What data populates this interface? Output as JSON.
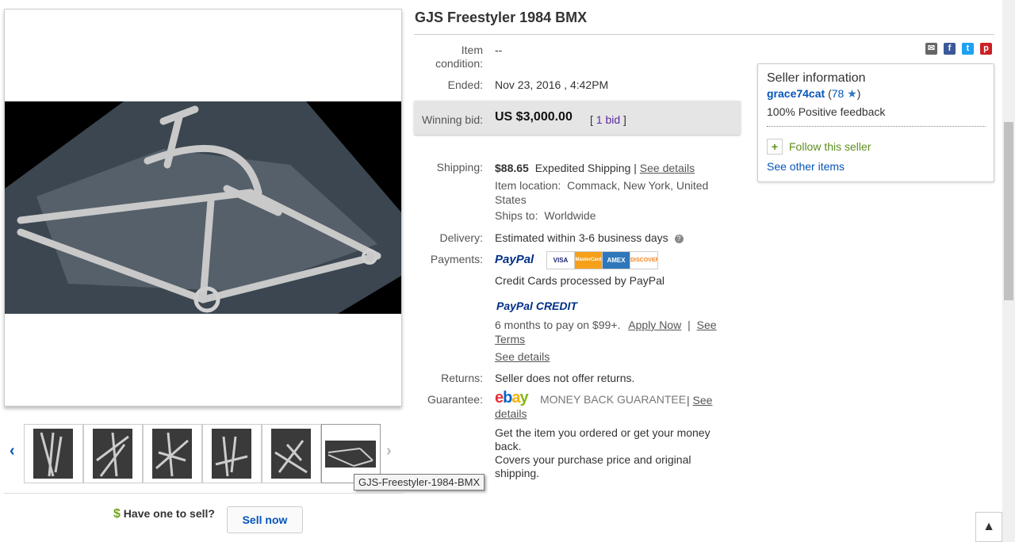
{
  "title": "GJS Freestyler 1984 BMX",
  "details": {
    "condition_label": "Item condition:",
    "condition_value": "--",
    "ended_label": "Ended:",
    "ended_value": "Nov 23, 2016 , 4:42PM",
    "winning_label": "Winning bid:",
    "winning_value": "US $3,000.00",
    "bids_open": "[",
    "bids_link": "1 bid",
    "bids_close": "]",
    "shipping_label": "Shipping:",
    "shipping_cost": "$88.65",
    "shipping_method": "Expedited Shipping |",
    "shipping_see_details": "See details",
    "location_label": "Item location:",
    "location_value_1": "Commack, New York, United",
    "location_value_2": "States",
    "ships_to_label": "Ships to:",
    "ships_to_value": "Worldwide",
    "delivery_label": "Delivery:",
    "delivery_value": "Estimated within 3-6 business days",
    "payments_label": "Payments:",
    "paypal_logo": "PayPal",
    "cards": [
      "VISA",
      "MasterCard",
      "AMEX",
      "DISCOVER"
    ],
    "credit_cards_text": "Credit Cards processed by PayPal",
    "paypal_credit_logo_a": "PayPal",
    "paypal_credit_logo_b": "CREDIT",
    "credit_offer": "6 months to pay on $99+.",
    "apply_now": "Apply Now",
    "pipe": "|",
    "see_terms_1": "See",
    "see_terms_2": "Terms",
    "payments_see_details": "See details",
    "returns_label": "Returns:",
    "returns_value": "Seller does not offer returns.",
    "guarantee_label": "Guarantee:",
    "mbg_text": "MONEY BACK GUARANTEE",
    "guarantee_pipe": "|",
    "guarantee_see_1": "See",
    "guarantee_see_2": "details",
    "guarantee_line_1": "Get the item you ordered or get your money",
    "guarantee_line_2": "back.",
    "guarantee_line_3": "Covers your purchase price and original",
    "guarantee_line_4": "shipping."
  },
  "seller": {
    "heading": "Seller information",
    "username": "grace74cat",
    "feedback_open": "(",
    "feedback_score": "78",
    "feedback_close": ")",
    "positive": "100% Positive feedback",
    "follow": "Follow this seller",
    "other_items": "See other items"
  },
  "gallery": {
    "tooltip": "GJS-Freestyler-1984-BMX",
    "prev_icon": "chevron-left-icon",
    "next_icon": "chevron-right-icon"
  },
  "sell": {
    "dollar": "$",
    "prompt": "Have one to sell?",
    "button": "Sell now"
  },
  "colors": {
    "link_blue": "#0654ba",
    "follow_green": "#5d8f1d",
    "bid_box": "#e5e5e5",
    "facebook": "#3b5998",
    "twitter": "#1da1f2",
    "pinterest": "#cb2027"
  }
}
